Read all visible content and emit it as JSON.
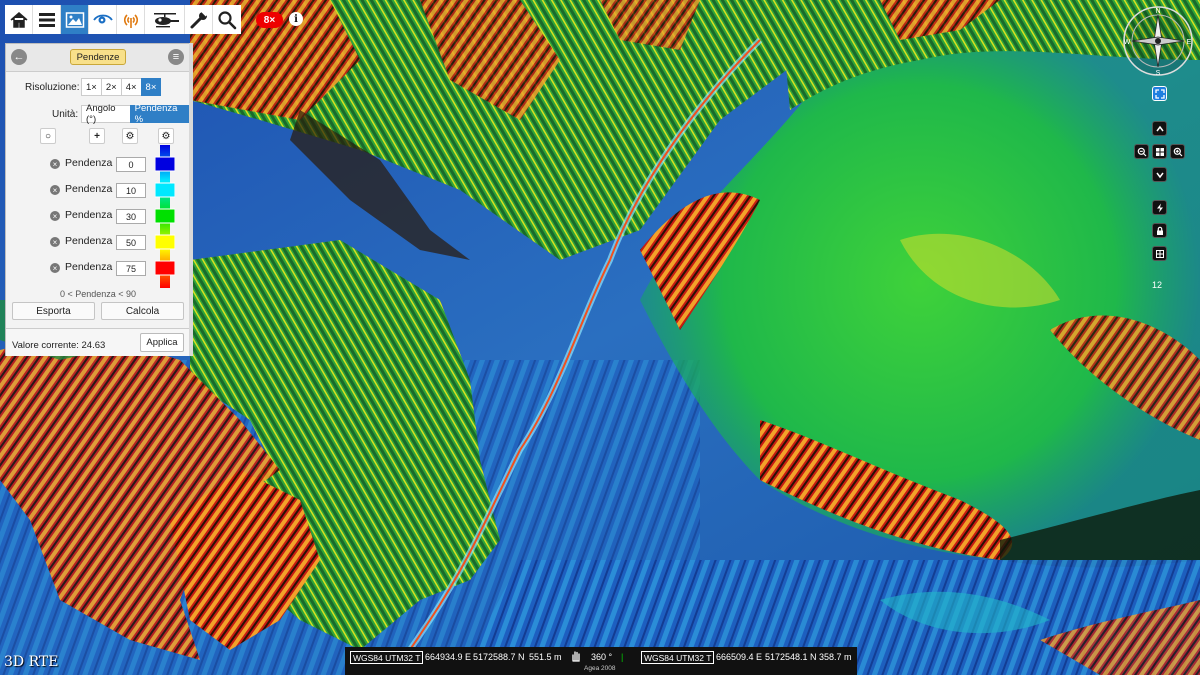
{
  "toolbar": {
    "buttons": [
      {
        "name": "home",
        "icon": "home-icon"
      },
      {
        "name": "menu",
        "icon": "menu-icon"
      },
      {
        "name": "image",
        "icon": "image-icon",
        "active": true
      },
      {
        "name": "eye",
        "icon": "eye-icon"
      },
      {
        "name": "signal",
        "icon": "signal-icon"
      },
      {
        "name": "helicopter",
        "icon": "helicopter-icon"
      },
      {
        "name": "wrench",
        "icon": "wrench-icon"
      },
      {
        "name": "search",
        "icon": "search-icon"
      }
    ],
    "resolution_badge": "8×",
    "info": "i"
  },
  "panel": {
    "title": "Pendenze",
    "resolution_label": "Risoluzione:",
    "resolution_options": [
      "1×",
      "2×",
      "4×",
      "8×"
    ],
    "resolution_selected": "8×",
    "unit_label": "Unità:",
    "unit_options": [
      "Angolo (°)",
      "Pendenza %"
    ],
    "unit_selected": "Pendenza %",
    "rows": [
      {
        "label": "Pendenza",
        "value": "0",
        "color": "#0000e0"
      },
      {
        "label": "Pendenza",
        "value": "10",
        "color": "#00e8ff"
      },
      {
        "label": "Pendenza",
        "value": "30",
        "color": "#00e000"
      },
      {
        "label": "Pendenza",
        "value": "50",
        "color": "#ffff00"
      },
      {
        "label": "Pendenza",
        "value": "75",
        "color": "#ff0000"
      }
    ],
    "range_note": "0 < Pendenza < 90",
    "export_label": "Esporta",
    "compute_label": "Calcola",
    "current_value_label": "Valore corrente: 24.63",
    "apply_label": "Applica"
  },
  "nav": {
    "compass_labels": [
      "N",
      "E",
      "S",
      "W"
    ],
    "zoom_label": "12"
  },
  "brand": "3D RTE",
  "status": {
    "crs1": "WGS84 UTM32 T",
    "e1": "664934.9 E",
    "n1": "5172588.7 N",
    "h1": "551.5 m",
    "angle": "360 °",
    "crs2": "WGS84 UTM32 T",
    "e2": "666509.4 E",
    "n2": "5172548.1 N",
    "h2": "358.7 m",
    "source": "Agea 2008"
  },
  "colors": {
    "accent": "#2f7fc6",
    "badge": "#ee0000",
    "slope_low": "#0000e0",
    "slope_high": "#ff0000"
  }
}
